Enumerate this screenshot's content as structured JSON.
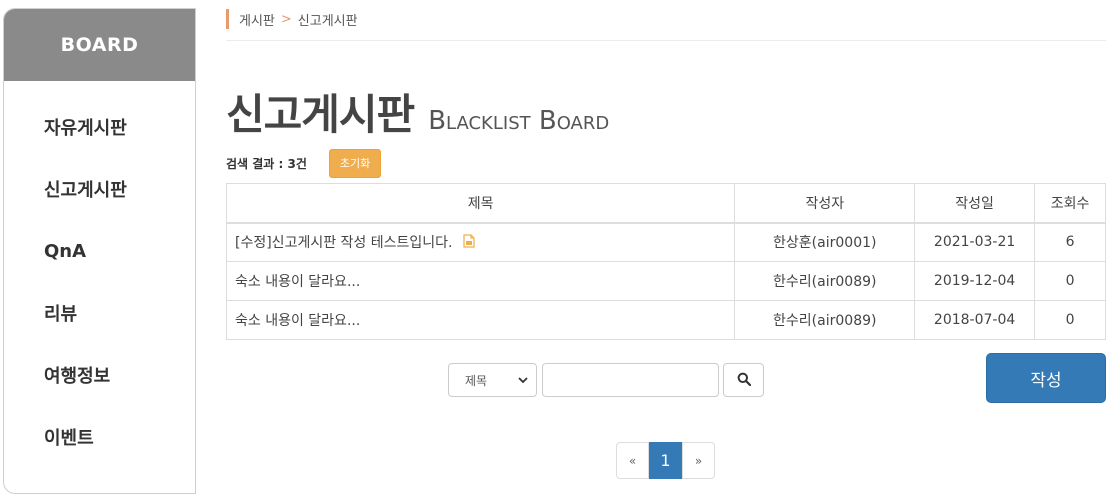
{
  "sidebar": {
    "header": "BOARD",
    "items": [
      {
        "label": "자유게시판"
      },
      {
        "label": "신고게시판"
      },
      {
        "label": "QnA"
      },
      {
        "label": "리뷰"
      },
      {
        "label": "여행정보"
      },
      {
        "label": "이벤트"
      }
    ]
  },
  "breadcrumb": {
    "parent": "게시판",
    "separator": ">",
    "current": "신고게시판"
  },
  "page": {
    "title": "신고게시판",
    "subtitle": "Blacklist Board"
  },
  "result": {
    "label": "검색 결과 : 3건",
    "reset_label": "초기화"
  },
  "table": {
    "headers": {
      "title": "제목",
      "author": "작성자",
      "date": "작성일",
      "views": "조회수"
    },
    "rows": [
      {
        "title": "[수정]신고게시판 작성 테스트입니다.",
        "author": "한상훈(air0001)",
        "date": "2021-03-21",
        "views": "6",
        "has_attachment": true
      },
      {
        "title": "숙소 내용이 달라요...",
        "author": "한수리(air0089)",
        "date": "2019-12-04",
        "views": "0",
        "has_attachment": false
      },
      {
        "title": "숙소 내용이 달라요...",
        "author": "한수리(air0089)",
        "date": "2018-07-04",
        "views": "0",
        "has_attachment": false
      }
    ]
  },
  "search": {
    "select_value": "제목",
    "input_value": "",
    "icon": "search-icon"
  },
  "write_button": {
    "label": "작성"
  },
  "pagination": {
    "prev": "«",
    "current": "1",
    "next": "»"
  },
  "colors": {
    "accent_blue": "#337ab7",
    "reset_orange": "#f0ad4e",
    "breadcrumb_accent": "#e89a6a",
    "sidebar_header": "#8a8a8a"
  }
}
